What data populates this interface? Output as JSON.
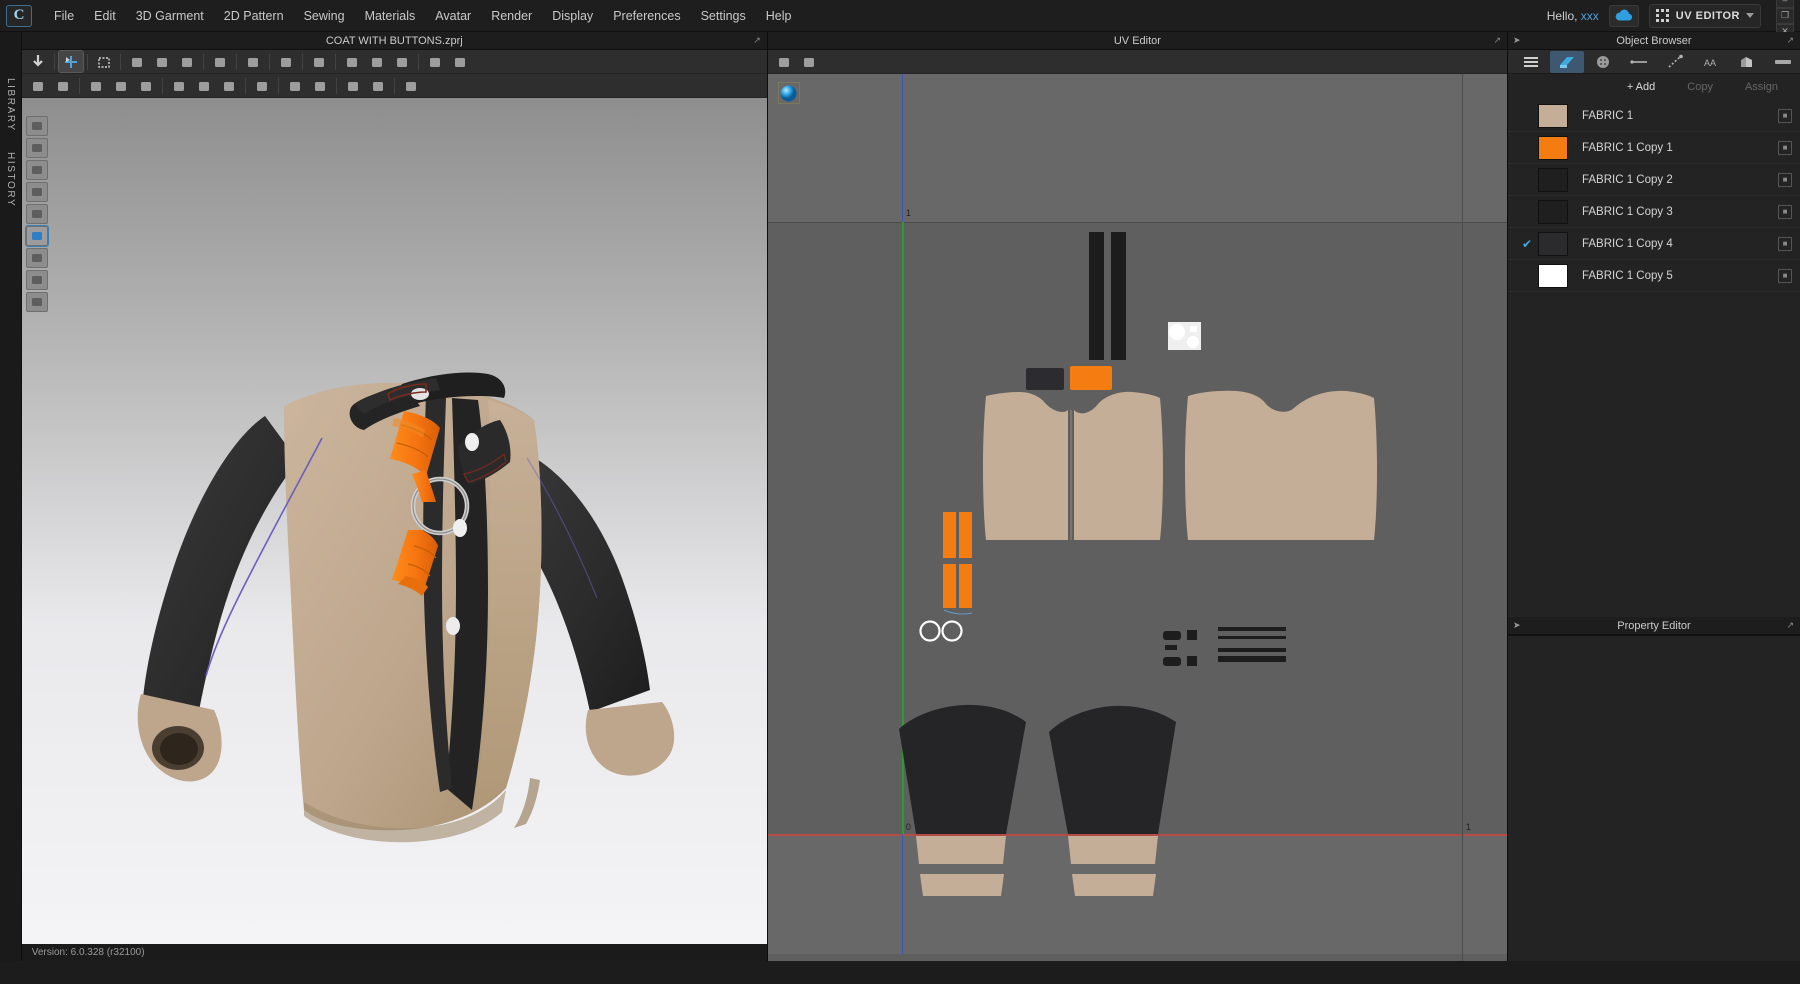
{
  "app": {
    "logo_letter": "C",
    "version_status": "Version: 6.0.328 (r32100)"
  },
  "menubar": {
    "items": [
      {
        "label": "File"
      },
      {
        "label": "Edit"
      },
      {
        "label": "3D Garment"
      },
      {
        "label": "2D Pattern"
      },
      {
        "label": "Sewing"
      },
      {
        "label": "Materials"
      },
      {
        "label": "Avatar"
      },
      {
        "label": "Render"
      },
      {
        "label": "Display"
      },
      {
        "label": "Preferences"
      },
      {
        "label": "Settings"
      },
      {
        "label": "Help"
      }
    ],
    "greeting_prefix": "Hello,",
    "user_name": "xxx",
    "cloud_icon": "cloud-icon",
    "mode_label": "UV EDITOR",
    "mode_icon": "uv-grid-icon",
    "window_buttons": [
      {
        "name": "minimize-button",
        "glyph": "–"
      },
      {
        "name": "restore-button",
        "glyph": "❐"
      },
      {
        "name": "close-button",
        "glyph": "✕"
      }
    ]
  },
  "rail": {
    "tabs": [
      {
        "label": "LIBRARY",
        "name": "rail-tab-library"
      },
      {
        "label": "HISTORY",
        "name": "rail-tab-history"
      }
    ]
  },
  "panel3d": {
    "title": "COAT WITH BUTTONS.zprj",
    "toolbar_row1": [
      "select-mesh-icon",
      "move-gizmo-icon",
      "select-box-icon",
      "fold-arrange-icon",
      "arrange-curve-icon",
      "arrange-reverse-icon",
      "fold-plane-icon",
      "pin-icon",
      "tack-icon",
      "sphere-pin-icon",
      "inflate-icon",
      "symmetric-icon",
      "garment-icon",
      "flatten-icon",
      "garment-fit-icon"
    ],
    "toolbar_row2": [
      "scissors-icon",
      "trim-icon",
      "fur-brush-icon",
      "fabric-brush-icon",
      "texture-brush-icon",
      "button-icon",
      "button-hole-icon",
      "lock-button-icon",
      "zipper-icon",
      "topstitch-icon",
      "tape-icon",
      "trim-tape-icon",
      "binding-icon",
      "puckering-icon"
    ],
    "mode_buttons": [
      {
        "name": "garment-mode-icon",
        "active": false
      },
      {
        "name": "tshirt-mode-icon",
        "active": false
      },
      {
        "name": "fabric-texture-icon",
        "active": false
      },
      {
        "name": "color-pick-icon",
        "active": false
      },
      {
        "name": "avatar-mode-icon",
        "active": false
      },
      {
        "name": "uv-map-icon",
        "active": true
      },
      {
        "name": "shade-mode-icon",
        "active": false
      },
      {
        "name": "avatar-head-icon",
        "active": false
      },
      {
        "name": "globe-env-icon",
        "active": false
      }
    ],
    "garment_colors": {
      "body_tan": "#bfa88f",
      "sleeve_black": "#2b2b2b",
      "strap_orange": "#f57c10",
      "button_white": "#f2f2f2",
      "ring_silver": "#d8d8d8"
    }
  },
  "panelUV": {
    "title": "UV Editor",
    "toolbar": [
      "uv-snapshot-icon",
      "uv-3d-snapshot-icon"
    ],
    "sphere_icon": "uv-sphere-icon",
    "axis_marks": [
      {
        "label": "0",
        "name": "uv-origin-mark"
      },
      {
        "label": "1",
        "name": "uv-unit-mark-right"
      },
      {
        "label": "1",
        "name": "uv-unit-mark-top"
      }
    ],
    "guide_colors": {
      "u_axis_red": "#b44b44",
      "v_axis_green": "#2f9c2f",
      "v_axis_blue": "#3f54b8",
      "grid_line": "#4e4e4e",
      "canvas_bg": "#5f5f5f",
      "band_bg": "#666666"
    },
    "pieces": [
      {
        "name": "front-left-panel",
        "fabric": "FABRIC 1",
        "color": "#c4ae97"
      },
      {
        "name": "front-right-panel",
        "fabric": "FABRIC 1",
        "color": "#c4ae97"
      },
      {
        "name": "back-panel",
        "fabric": "FABRIC 1",
        "color": "#c4ae97"
      },
      {
        "name": "placket-strip-left",
        "fabric": "FABRIC 1 Copy 4",
        "color": "#1d1d1d"
      },
      {
        "name": "placket-strip-right",
        "fabric": "FABRIC 1 Copy 4",
        "color": "#1d1d1d"
      },
      {
        "name": "collar-dark",
        "fabric": "FABRIC 1 Copy 4",
        "color": "#2c2c30"
      },
      {
        "name": "collar-orange",
        "fabric": "FABRIC 1 Copy 1",
        "color": "#f57c10"
      },
      {
        "name": "button-cluster",
        "fabric": "FABRIC 1 Copy 5",
        "color": "#ffffff"
      },
      {
        "name": "strap-orange-1",
        "fabric": "FABRIC 1 Copy 1",
        "color": "#f57c10"
      },
      {
        "name": "strap-orange-2",
        "fabric": "FABRIC 1 Copy 1",
        "color": "#f57c10"
      },
      {
        "name": "strap-orange-3",
        "fabric": "FABRIC 1 Copy 1",
        "color": "#f57c10"
      },
      {
        "name": "strap-orange-4",
        "fabric": "FABRIC 1 Copy 1",
        "color": "#f57c10"
      },
      {
        "name": "ring-outline-1",
        "fabric": "FABRIC 1 Copy 5",
        "color": "#ffffff"
      },
      {
        "name": "ring-outline-2",
        "fabric": "FABRIC 1 Copy 5",
        "color": "#ffffff"
      },
      {
        "name": "sleeve-left",
        "fabric": "FABRIC 1 Copy 2",
        "color": "#252528"
      },
      {
        "name": "sleeve-right",
        "fabric": "FABRIC 1 Copy 2",
        "color": "#252528"
      },
      {
        "name": "cuff-left",
        "fabric": "FABRIC 1",
        "color": "#c4ae97"
      },
      {
        "name": "cuff-right",
        "fabric": "FABRIC 1",
        "color": "#c4ae97"
      },
      {
        "name": "pocket-detail-group",
        "fabric": "FABRIC 1 Copy 3",
        "color": "#1d1d1d"
      },
      {
        "name": "trim-lines-group",
        "fabric": "FABRIC 1 Copy 3",
        "color": "#1d1d1d"
      }
    ]
  },
  "objectBrowser": {
    "title": "Object Browser",
    "tabs": [
      {
        "name": "tab-list-view",
        "icon": "list-icon",
        "active": false
      },
      {
        "name": "tab-fabric",
        "icon": "fabric-swatch-icon",
        "active": true
      },
      {
        "name": "tab-button",
        "icon": "button-icon",
        "active": false
      },
      {
        "name": "tab-topstitch",
        "icon": "stitch-line-icon",
        "active": false
      },
      {
        "name": "tab-zipper",
        "icon": "zipper-icon",
        "active": false
      },
      {
        "name": "tab-graphic",
        "icon": "graphic-icon",
        "active": false
      },
      {
        "name": "tab-trim",
        "icon": "trim-icon",
        "active": false
      },
      {
        "name": "tab-tape",
        "icon": "tape-icon",
        "active": false
      }
    ],
    "actions": [
      {
        "label": "+ Add",
        "name": "add-button",
        "enabled": true
      },
      {
        "label": "Copy",
        "name": "copy-button",
        "enabled": false
      },
      {
        "label": "Assign",
        "name": "assign-button",
        "enabled": false
      }
    ],
    "fabrics": [
      {
        "label": "FABRIC 1",
        "color": "#c4ae97",
        "checked": false
      },
      {
        "label": "FABRIC 1 Copy 1",
        "color": "#f57c10",
        "checked": false
      },
      {
        "label": "FABRIC 1 Copy 2",
        "color": "#201f1f",
        "checked": false
      },
      {
        "label": "FABRIC 1 Copy 3",
        "color": "#201f1f",
        "checked": false
      },
      {
        "label": "FABRIC 1 Copy 4",
        "color": "#2b2b2e",
        "checked": true
      },
      {
        "label": "FABRIC 1 Copy 5",
        "color": "#ffffff",
        "checked": false
      }
    ],
    "check_glyph": "✔",
    "more_glyph": "■"
  },
  "propertyEditor": {
    "title": "Property Editor"
  }
}
